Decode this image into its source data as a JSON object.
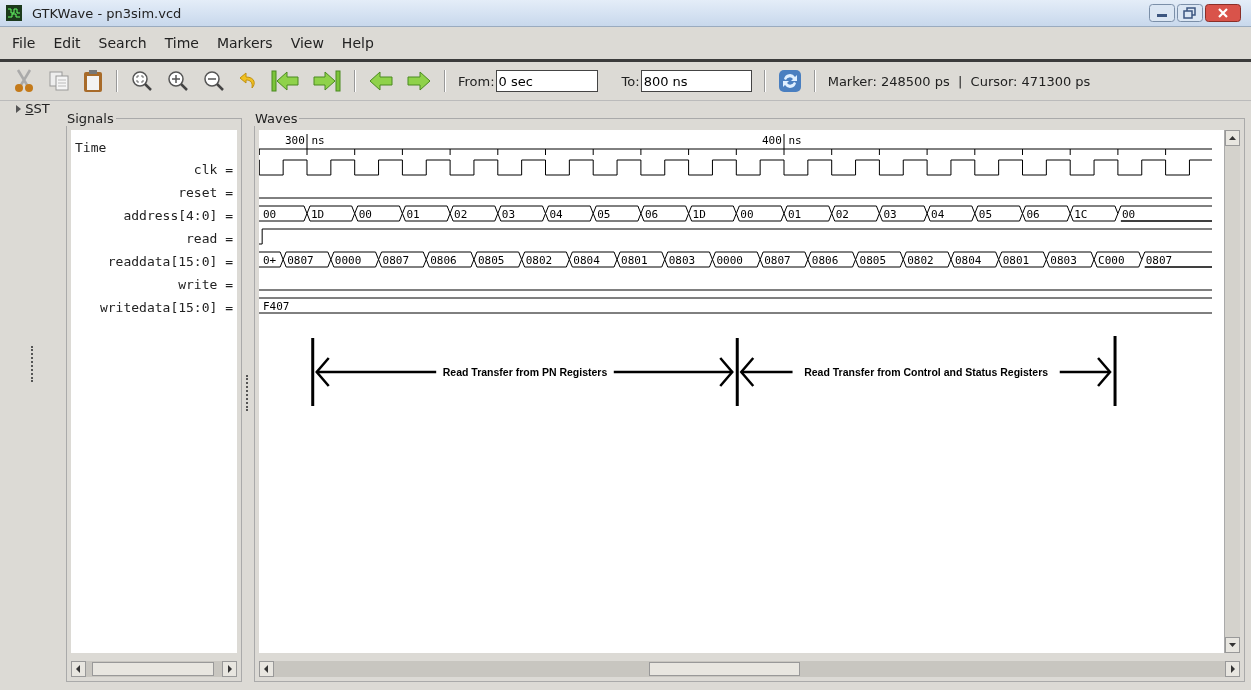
{
  "window": {
    "title": "GTKWave - pn3sim.vcd"
  },
  "menu": [
    "File",
    "Edit",
    "Search",
    "Time",
    "Markers",
    "View",
    "Help"
  ],
  "toolbar": {
    "from_label": "From:",
    "from_value": "0 sec",
    "to_label": "To:",
    "to_value": "800 ns",
    "status": "Marker: 248500 ps  |  Cursor: 471300 ps"
  },
  "sst": {
    "label": "SST",
    "expanded": false
  },
  "signals": {
    "title": "Signals",
    "header": "Time",
    "items": [
      "clk =",
      "reset =",
      "address[4:0] =",
      "read =",
      "readdata[15:0] =",
      "write =",
      "writedata[15:0] ="
    ]
  },
  "waves": {
    "title": "Waves",
    "time_labels": [
      "300 ns",
      "400 ns"
    ],
    "traces": [
      {
        "kind": "clock"
      },
      {
        "kind": "low"
      },
      {
        "kind": "bus",
        "values": [
          "00",
          "1D",
          "00",
          "01",
          "02",
          "03",
          "04",
          "05",
          "06",
          "1D",
          "00",
          "01",
          "02",
          "03",
          "04",
          "05",
          "06",
          "1C",
          "00"
        ]
      },
      {
        "kind": "rise"
      },
      {
        "kind": "skewbus",
        "values": [
          "0+",
          "0807",
          "0000",
          "0807",
          "0806",
          "0805",
          "0802",
          "0804",
          "0801",
          "0803",
          "0000",
          "0807",
          "0806",
          "0805",
          "0802",
          "0804",
          "0801",
          "0803",
          "C000",
          "0807"
        ]
      },
      {
        "kind": "low"
      },
      {
        "kind": "bus",
        "values": [
          "F407"
        ]
      }
    ],
    "annotations": [
      {
        "text": "Read Transfer from PN Registers"
      },
      {
        "text": "Read Transfer from Control and Status Registers"
      }
    ]
  }
}
